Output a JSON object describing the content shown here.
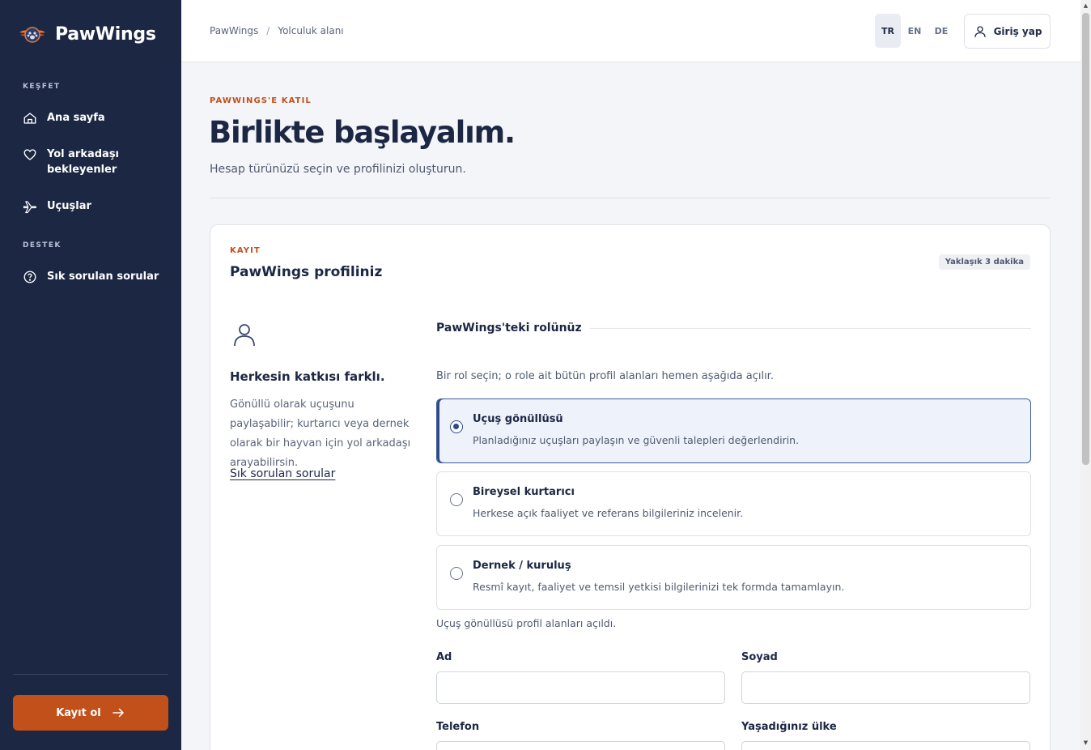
{
  "app": {
    "name": "PawWings"
  },
  "sidebar": {
    "section_explore": "KEŞFET",
    "items": [
      {
        "label": "Ana sayfa",
        "icon": "home-icon"
      },
      {
        "label": "Yol arkadaşı bekleyenler",
        "icon": "heart-icon"
      },
      {
        "label": "Uçuşlar",
        "icon": "plane-icon"
      }
    ],
    "section_support": "DESTEK",
    "support_items": [
      {
        "label": "Sık sorulan sorular",
        "icon": "help-circle-icon"
      }
    ],
    "signup_label": "Kayıt ol"
  },
  "topbar": {
    "breadcrumb": [
      "PawWings",
      "/",
      "Yolculuk alanı"
    ],
    "languages": [
      "TR",
      "EN",
      "DE"
    ],
    "active_language": "TR",
    "login_label": "Giriş yap"
  },
  "header": {
    "eyebrow": "PAWWINGS'E KATIL",
    "title": "Birlikte başlayalım.",
    "subtitle": "Hesap türünüzü seçin ve profilinizi oluşturun."
  },
  "card": {
    "eyebrow": "KAYIT",
    "title": "PawWings profiliniz",
    "time_badge": "Yaklaşık 3 dakika",
    "side": {
      "title": "Herkesin katkısı farklı.",
      "text": "Gönüllü olarak uçuşunu paylaşabilir; kurtarıcı veya dernek olarak bir hayvan için yol arkadaşı arayabilirsin.",
      "link": "Sık sorulan sorular"
    },
    "role_heading": "PawWings'teki rolünüz",
    "role_hint": "Bir rol seçin; o role ait bütün profil alanları hemen aşağıda açılır.",
    "roles": [
      {
        "title": "Uçuş gönüllüsü",
        "desc": "Planladığınız uçuşları paylaşın ve güvenli talepleri değerlendirin.",
        "selected": true
      },
      {
        "title": "Bireysel kurtarıcı",
        "desc": "Herkese açık faaliyet ve referans bilgileriniz incelenir.",
        "selected": false
      },
      {
        "title": "Dernek / kuruluş",
        "desc": "Resmî kayıt, faaliyet ve temsil yetkisi bilgilerinizi tek formda tamamlayın.",
        "selected": false
      }
    ],
    "opened_note": "Uçuş gönüllüsü profil alanları açıldı.",
    "fields": {
      "first_name": {
        "label": "Ad",
        "value": ""
      },
      "last_name": {
        "label": "Soyad",
        "value": ""
      },
      "phone": {
        "label": "Telefon",
        "value": ""
      },
      "country": {
        "label": "Yaşadığınız ülke",
        "value": ""
      }
    }
  },
  "colors": {
    "sidebar_bg": "#1c2744",
    "accent": "#c1501a",
    "selected": "#2e4a8c"
  }
}
